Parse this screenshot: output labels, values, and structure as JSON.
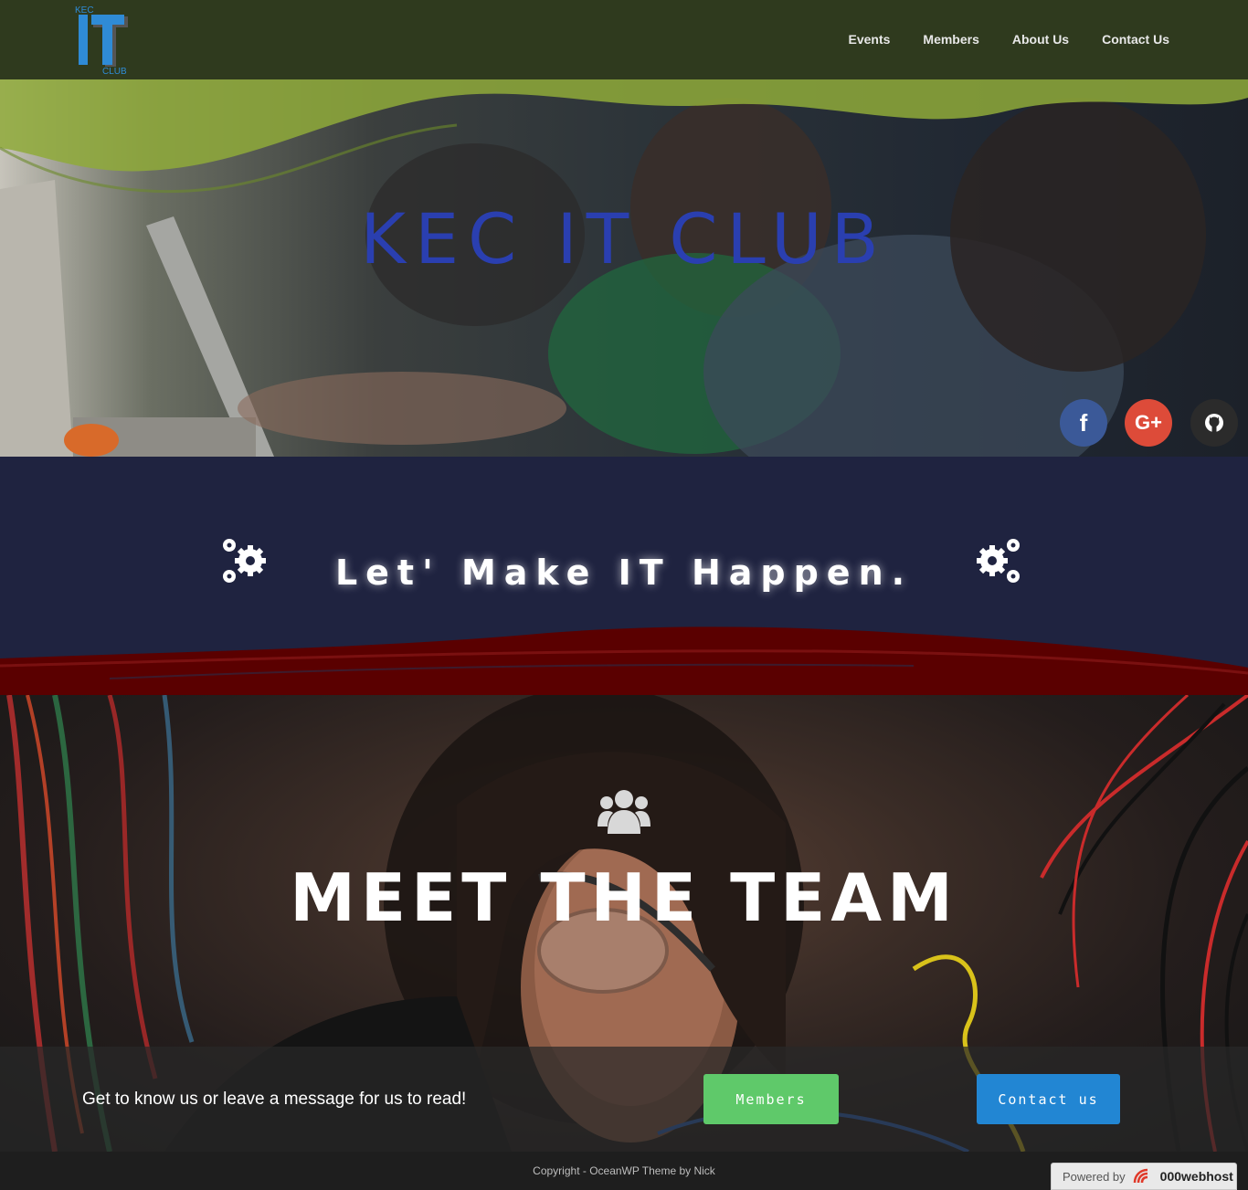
{
  "header": {
    "logo": {
      "top_text": "KEC",
      "main_text": "IT",
      "bottom_text": "CLUB"
    },
    "nav": [
      {
        "label": "Events"
      },
      {
        "label": "Members"
      },
      {
        "label": "About Us"
      },
      {
        "label": "Contact Us"
      }
    ]
  },
  "hero": {
    "title": "KEC IT CLUB",
    "social": [
      {
        "icon": "facebook-icon",
        "label": "f",
        "color": "#3b5998"
      },
      {
        "icon": "google-plus-icon",
        "label": "G+",
        "color": "#dd4b39"
      },
      {
        "icon": "github-icon",
        "label": "",
        "color": "#2b2b2b"
      }
    ]
  },
  "band": {
    "tagline": "Let' Make IT Happen.",
    "left_icon": "gears-icon",
    "right_icon": "gears-icon",
    "background": "#1f2340",
    "accent": "#6b0000"
  },
  "team": {
    "icon": "users-icon",
    "title": "MEET THE TEAM",
    "cta_text": "Get to know us or leave a message for us to read!",
    "members_button": "Members",
    "contact_button": "Contact us",
    "members_color": "#5fc96a",
    "contact_color": "#2286d3"
  },
  "footer": {
    "copyright": "Copyright - OceanWP Theme by Nick",
    "powered_by": "Powered by",
    "host": "000webhost"
  }
}
